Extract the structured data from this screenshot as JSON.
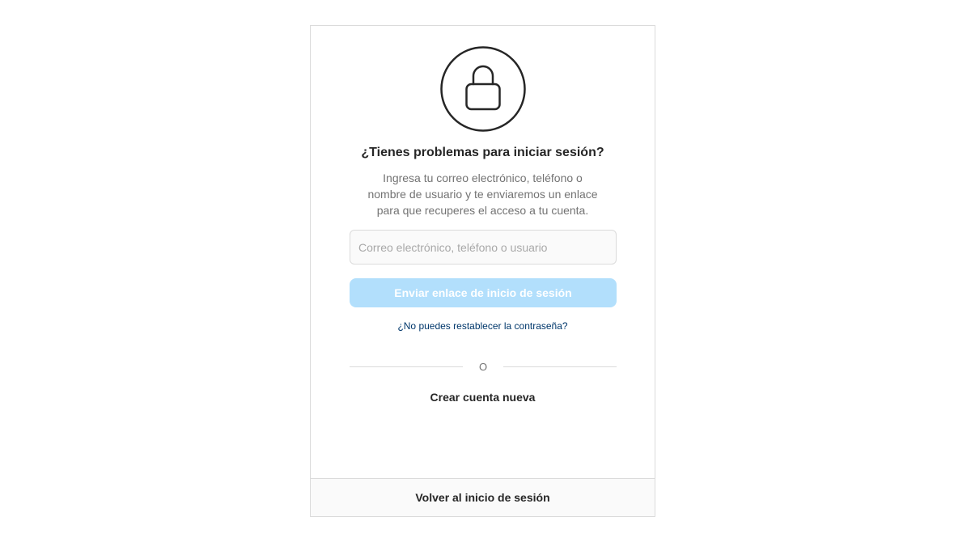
{
  "card": {
    "icon": "lock-icon",
    "title": "¿Tienes problemas para iniciar sesión?",
    "description_lines": [
      "Ingresa tu correo electrónico, teléfono o",
      "nombre de usuario y te enviaremos un enlace",
      "para que recuperes el acceso a tu cuenta."
    ],
    "input": {
      "placeholder": "Correo electrónico, teléfono o usuario",
      "value": ""
    },
    "send_button_label": "Enviar enlace de inicio de sesión",
    "reset_link_label": "¿No puedes restablecer la contraseña?",
    "divider_text": "O",
    "create_account_label": "Crear cuenta nueva"
  },
  "footer": {
    "back_to_login_label": "Volver al inicio de sesión"
  },
  "colors": {
    "primary_disabled": "#b2dffc",
    "link": "#00376b",
    "text": "#262626",
    "secondary_text": "#737373",
    "border": "#dbdbdb"
  }
}
